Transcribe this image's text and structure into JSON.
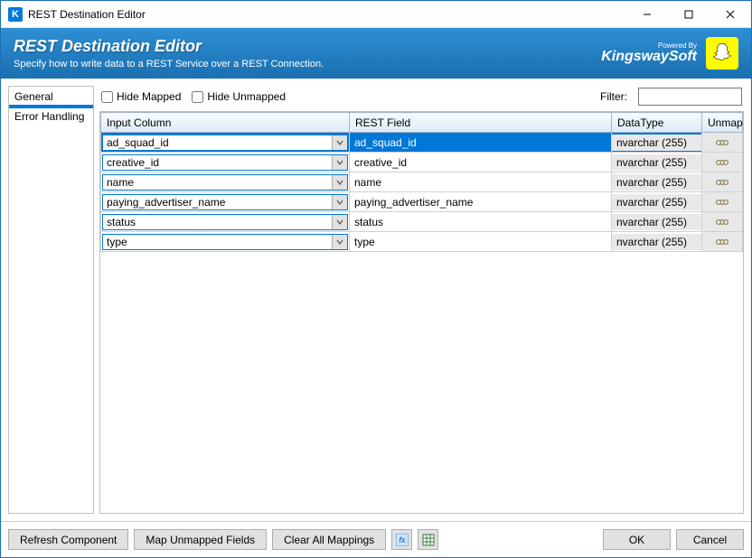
{
  "window": {
    "title": "REST Destination Editor"
  },
  "banner": {
    "title": "REST Destination Editor",
    "subtitle": "Specify how to write data to a REST Service over a REST Connection.",
    "powered_by": "Powered By",
    "brand": "KingswaySoft"
  },
  "sidebar": {
    "items": [
      {
        "label": "General",
        "selected": false
      },
      {
        "label": "",
        "selected": true
      },
      {
        "label": "Error Handling",
        "selected": false
      }
    ]
  },
  "toolbar": {
    "hide_mapped_label": "Hide Mapped",
    "hide_unmapped_label": "Hide Unmapped",
    "filter_label": "Filter:",
    "filter_value": ""
  },
  "grid": {
    "headers": {
      "input_column": "Input Column",
      "rest_field": "REST Field",
      "data_type": "DataType",
      "unmap": "Unmap"
    },
    "rows": [
      {
        "input": "ad_squad_id",
        "rest": "ad_squad_id",
        "dtype": "nvarchar (255)",
        "selected": true
      },
      {
        "input": "creative_id",
        "rest": "creative_id",
        "dtype": "nvarchar (255)",
        "selected": false
      },
      {
        "input": "name",
        "rest": "name",
        "dtype": "nvarchar (255)",
        "selected": false
      },
      {
        "input": "paying_advertiser_name",
        "rest": "paying_advertiser_name",
        "dtype": "nvarchar (255)",
        "selected": false
      },
      {
        "input": "status",
        "rest": "status",
        "dtype": "nvarchar (255)",
        "selected": false
      },
      {
        "input": "type",
        "rest": "type",
        "dtype": "nvarchar (255)",
        "selected": false
      }
    ]
  },
  "footer": {
    "refresh_label": "Refresh Component",
    "map_unmapped_label": "Map Unmapped Fields",
    "clear_all_label": "Clear All Mappings",
    "ok_label": "OK",
    "cancel_label": "Cancel"
  }
}
